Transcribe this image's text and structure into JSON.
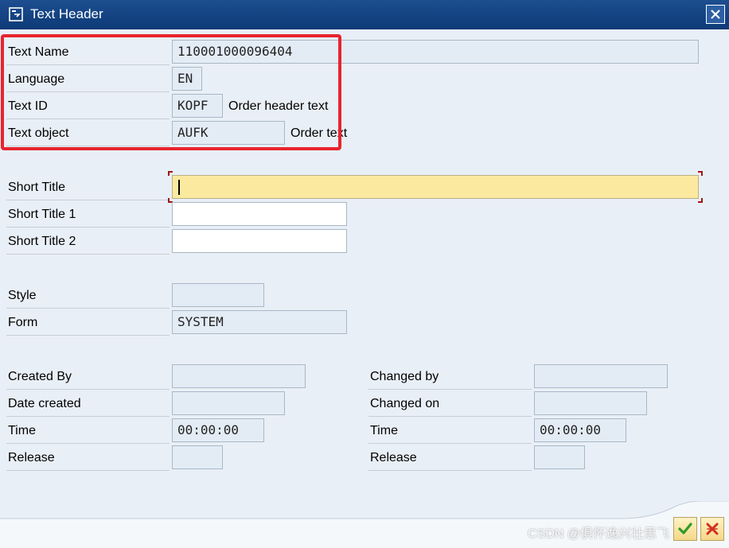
{
  "window": {
    "title": "Text Header"
  },
  "header_block": {
    "text_name": {
      "label": "Text Name",
      "value": "110001000096404"
    },
    "language": {
      "label": "Language",
      "value": "EN"
    },
    "text_id": {
      "label": "Text ID",
      "value": "KOPF",
      "description": "Order header text"
    },
    "text_object": {
      "label": "Text object",
      "value": "AUFK",
      "description": "Order text"
    }
  },
  "titles": {
    "short_title": {
      "label": "Short Title",
      "value": ""
    },
    "short_title_1": {
      "label": "Short Title 1",
      "value": ""
    },
    "short_title_2": {
      "label": "Short Title 2",
      "value": ""
    }
  },
  "layout_block": {
    "style": {
      "label": "Style",
      "value": ""
    },
    "form": {
      "label": "Form",
      "value": "SYSTEM"
    }
  },
  "admin_left": {
    "created_by": {
      "label": "Created By",
      "value": ""
    },
    "date_created": {
      "label": "Date created",
      "value": ""
    },
    "time": {
      "label": "Time",
      "value": "00:00:00"
    },
    "release": {
      "label": "Release",
      "value": ""
    }
  },
  "admin_right": {
    "changed_by": {
      "label": "Changed by",
      "value": ""
    },
    "changed_on": {
      "label": "Changed on",
      "value": ""
    },
    "time": {
      "label": "Time",
      "value": "00:00:00"
    },
    "release": {
      "label": "Release",
      "value": ""
    }
  },
  "footer": {
    "watermark": "CSDN @俱怀逸兴壮思飞"
  },
  "icons": {
    "title": "window-icon",
    "close": "close-icon",
    "confirm": "checkmark-icon",
    "cancel": "cancel-icon"
  },
  "colors": {
    "titlebar": "#0e3a78",
    "background": "#e9eff6",
    "highlight": "#e8242e",
    "focus_field": "#fce9a0"
  }
}
